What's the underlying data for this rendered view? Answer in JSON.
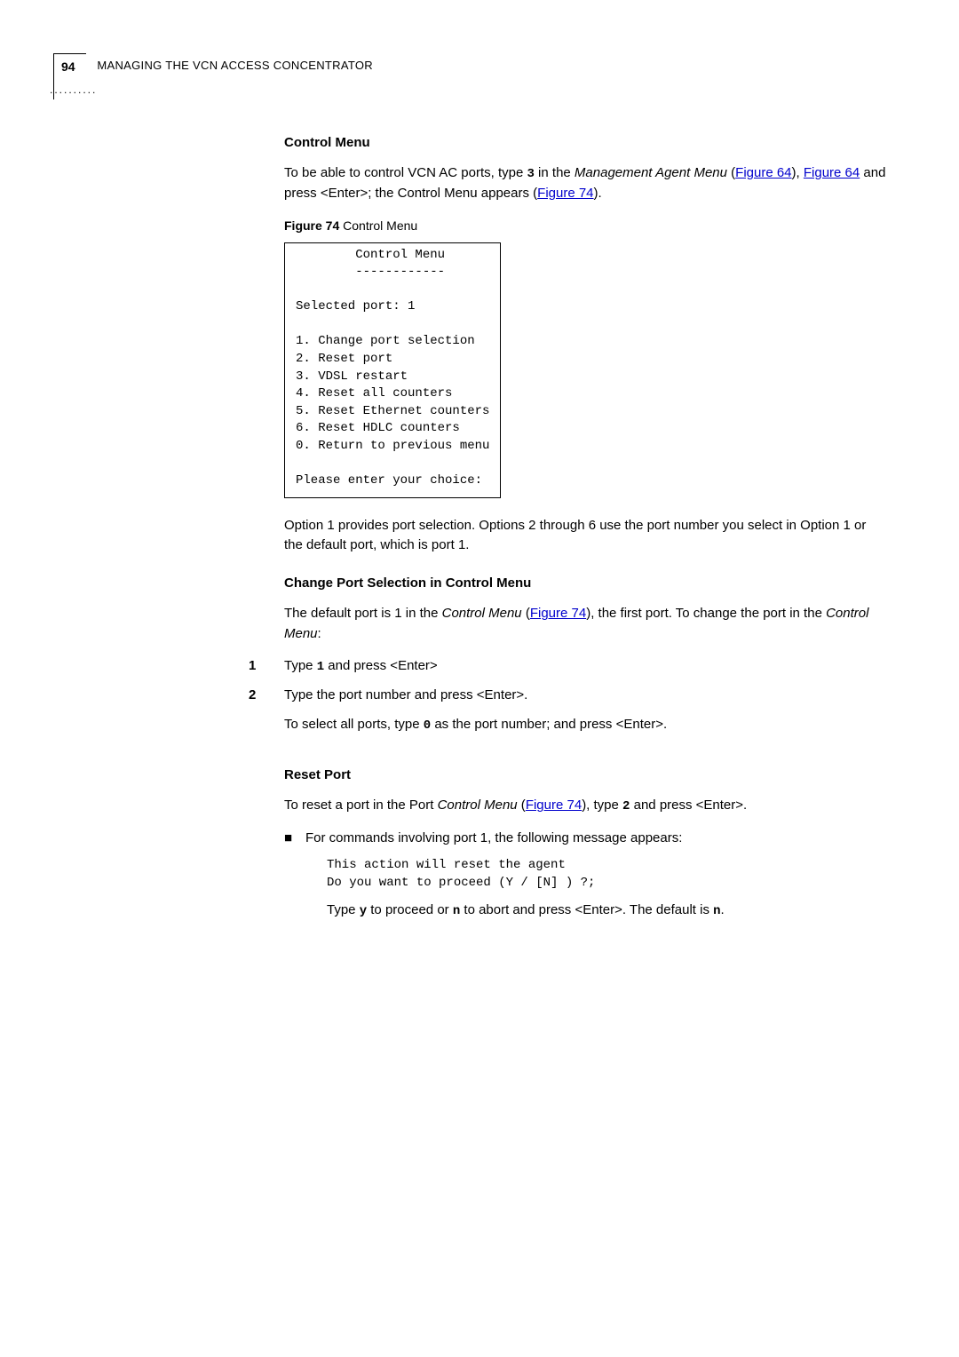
{
  "header": {
    "page_number": "94",
    "dotted_pattern": "..........",
    "running_title_a": "M",
    "running_title_b": "ANAGING THE",
    "running_title_c": " VCN A",
    "running_title_d": "CCESS",
    "running_title_e": " C",
    "running_title_f": "ONCENTRATOR"
  },
  "section1": {
    "heading": "Control Menu",
    "para1a": "To be able to control VCN AC ports, type ",
    "code1": "3",
    "para1b": " in the ",
    "italic1": "Management Agent Menu",
    "para1c": " (",
    "link1": "Figure 64",
    "para1d": "), ",
    "link2": "Figure 64",
    "para1e": " and press <Enter>; the Control Menu appears (",
    "link3": "Figure 74",
    "para1f": ")."
  },
  "figure": {
    "caption_label": "Figure 74   ",
    "caption_text": "Control Menu",
    "box": "        Control Menu\n        ------------\n\nSelected port: 1\n\n1. Change port selection\n2. Reset port\n3. VDSL restart\n4. Reset all counters\n5. Reset Ethernet counters\n6. Reset HDLC counters\n0. Return to previous menu\n\nPlease enter your choice:"
  },
  "section2": {
    "para": "Option 1 provides port selection. Options 2 through 6 use the port number you select in Option 1 or the default port, which is port 1."
  },
  "section3": {
    "heading": "Change Port Selection in Control Menu",
    "para1a": "The default port is 1 in the ",
    "italic1": "Control Menu",
    "para1b": " (",
    "link1": "Figure 74",
    "para1c": "), the first port. To change the port in the ",
    "italic2": "Control Menu",
    "para1d": ":",
    "step1_marker": "1",
    "step1a": "Type ",
    "step1_code": "1",
    "step1b": " and press <Enter>",
    "step2_marker": "2",
    "step2": "Type the port number and press <Enter>.",
    "para2a": "To select all ports, type ",
    "para2_code": "0",
    "para2b": " as the port number; and press <Enter>."
  },
  "section4": {
    "heading": "Reset Port",
    "para1a": "To reset a port in the Port ",
    "italic1": "Control Menu",
    "para1b": " (",
    "link1": "Figure 74",
    "para1c": "), type ",
    "code1": "2",
    "para1d": "  and press <Enter>.",
    "bullet": "■",
    "bullet_text": "For commands involving port 1, the following message appears:",
    "codeblock": "This action will reset the agent\nDo you want to proceed (Y / [N] ) ?;",
    "para2a": "Type ",
    "code_y": "y",
    "para2b": " to proceed or ",
    "code_n": "n",
    "para2c": " to abort and press <Enter>. The default is ",
    "code_n2": "n",
    "para2d": "."
  }
}
